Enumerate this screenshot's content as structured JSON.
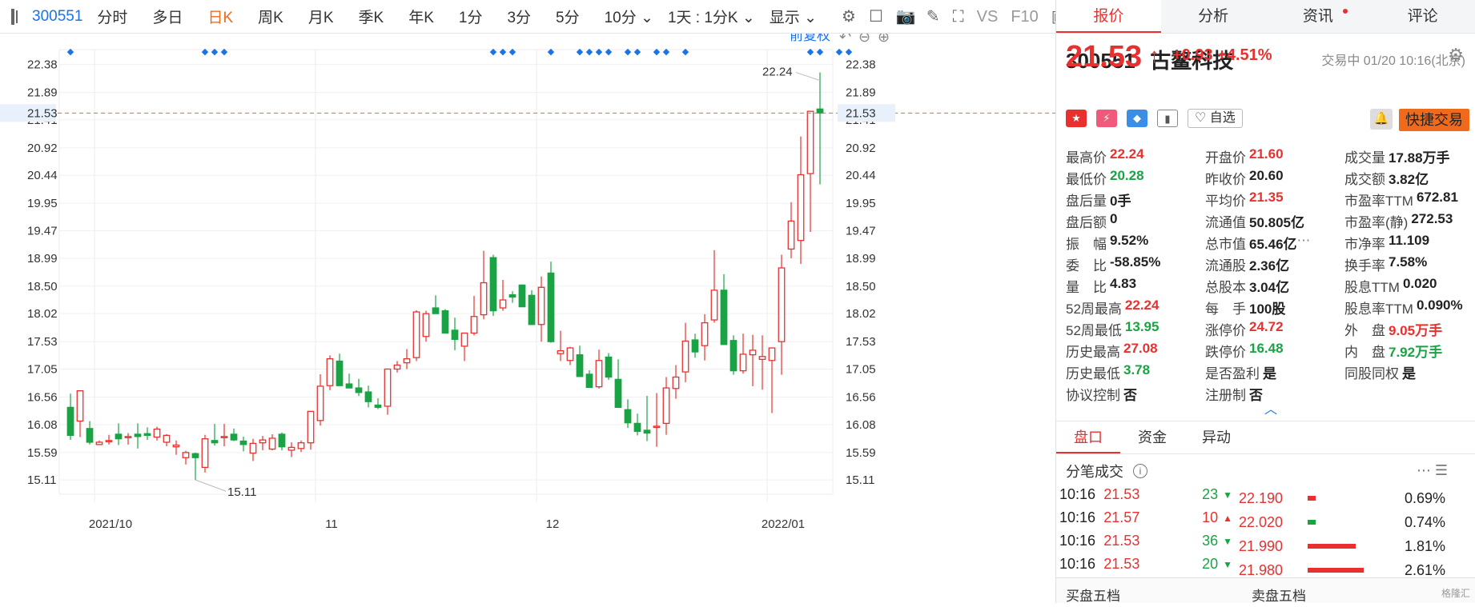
{
  "toolbar": {
    "code": "300551",
    "items": [
      "分时",
      "多日",
      "日K",
      "周K",
      "月K",
      "季K",
      "年K",
      "1分",
      "3分",
      "5分",
      "10分 ⌄",
      "1天 : 1分K ⌄",
      "显示 ⌄"
    ],
    "active_index": 2,
    "right_icons": [
      "gear-icon",
      "square-icon",
      "camera-icon",
      "pen-icon",
      "fullscreen-icon",
      "VS",
      "F10",
      "panel-icon"
    ]
  },
  "chart": {
    "restore_label": "前复权",
    "current_price_label": "21.53",
    "max_label": "22.24",
    "min_label": "15.11",
    "accent_red": "#e8312f",
    "accent_green": "#1aa345",
    "dash_line_color": "#f06a1c"
  },
  "chart_data": {
    "type": "candlestick",
    "y_ticks": [
      15.11,
      15.59,
      16.08,
      16.56,
      17.05,
      17.53,
      18.02,
      18.5,
      18.99,
      19.47,
      19.95,
      20.44,
      20.92,
      21.41,
      21.89,
      22.38
    ],
    "x_labels": [
      "2021/10",
      "11",
      "12",
      "2022/01"
    ],
    "ylim": [
      15.0,
      22.5
    ],
    "candles": [
      [
        16.38,
        16.62,
        15.81,
        15.89
      ],
      [
        16.14,
        16.67,
        15.86,
        16.67
      ],
      [
        16.01,
        16.14,
        15.73,
        15.77
      ],
      [
        15.73,
        15.8,
        15.72,
        15.77
      ],
      [
        15.8,
        15.9,
        15.73,
        15.8
      ],
      [
        15.91,
        16.1,
        15.72,
        15.83
      ],
      [
        15.85,
        15.93,
        15.73,
        15.87
      ],
      [
        15.91,
        16.1,
        15.66,
        15.87
      ],
      [
        15.92,
        16.03,
        15.81,
        15.89
      ],
      [
        15.86,
        16.04,
        15.8,
        16.0
      ],
      [
        15.77,
        15.91,
        15.7,
        15.89
      ],
      [
        15.69,
        15.8,
        15.55,
        15.72
      ],
      [
        15.5,
        15.62,
        15.38,
        15.59
      ],
      [
        15.57,
        15.59,
        15.11,
        15.5
      ],
      [
        15.33,
        15.9,
        15.24,
        15.83
      ],
      [
        15.8,
        16.09,
        15.71,
        15.76
      ],
      [
        15.85,
        16.09,
        15.7,
        15.87
      ],
      [
        15.91,
        16.01,
        15.79,
        15.81
      ],
      [
        15.79,
        15.87,
        15.61,
        15.73
      ],
      [
        15.58,
        15.83,
        15.44,
        15.75
      ],
      [
        15.76,
        15.88,
        15.63,
        15.81
      ],
      [
        15.65,
        15.91,
        15.63,
        15.84
      ],
      [
        15.91,
        15.94,
        15.63,
        15.69
      ],
      [
        15.63,
        15.77,
        15.51,
        15.68
      ],
      [
        15.66,
        15.8,
        15.6,
        15.76
      ],
      [
        15.76,
        16.31,
        15.64,
        16.31
      ],
      [
        16.15,
        16.96,
        16.06,
        16.75
      ],
      [
        16.76,
        17.29,
        16.68,
        17.23
      ],
      [
        17.19,
        17.32,
        16.82,
        16.76
      ],
      [
        16.79,
        16.97,
        16.72,
        16.72
      ],
      [
        16.72,
        16.88,
        16.58,
        16.64
      ],
      [
        16.65,
        16.76,
        16.38,
        16.48
      ],
      [
        16.42,
        16.54,
        16.35,
        16.38
      ],
      [
        16.4,
        17.06,
        16.25,
        17.05
      ],
      [
        17.05,
        17.19,
        16.99,
        17.12
      ],
      [
        17.16,
        17.4,
        17.05,
        17.23
      ],
      [
        17.25,
        18.08,
        17.19,
        18.05
      ],
      [
        17.62,
        18.07,
        17.53,
        18.02
      ],
      [
        18.12,
        18.34,
        18.03,
        18.02
      ],
      [
        18.07,
        18.1,
        17.8,
        17.68
      ],
      [
        17.73,
        17.95,
        17.38,
        17.57
      ],
      [
        17.45,
        17.68,
        17.19,
        17.68
      ],
      [
        17.68,
        18.33,
        17.64,
        17.97
      ],
      [
        18.0,
        19.12,
        17.92,
        18.56
      ],
      [
        19.0,
        19.05,
        17.98,
        18.07
      ],
      [
        18.12,
        18.61,
        18.07,
        18.26
      ],
      [
        18.35,
        18.41,
        18.21,
        18.31
      ],
      [
        18.52,
        18.53,
        18.22,
        18.14
      ],
      [
        18.34,
        18.43,
        17.82,
        17.83
      ],
      [
        17.83,
        18.67,
        17.53,
        18.48
      ],
      [
        18.73,
        18.93,
        17.51,
        17.53
      ],
      [
        17.32,
        17.72,
        17.19,
        17.37
      ],
      [
        17.2,
        17.44,
        17.12,
        17.42
      ],
      [
        17.3,
        17.46,
        16.95,
        16.92
      ],
      [
        16.96,
        17.03,
        16.77,
        16.73
      ],
      [
        16.74,
        17.39,
        16.71,
        17.2
      ],
      [
        17.26,
        17.33,
        16.86,
        16.91
      ],
      [
        16.87,
        17.22,
        16.52,
        16.38
      ],
      [
        16.34,
        16.52,
        16.02,
        16.11
      ],
      [
        16.1,
        16.27,
        15.89,
        15.96
      ],
      [
        15.98,
        16.58,
        15.79,
        15.93
      ],
      [
        16.04,
        16.63,
        15.69,
        16.05
      ],
      [
        16.1,
        16.91,
        15.9,
        16.72
      ],
      [
        16.71,
        17.12,
        16.53,
        16.91
      ],
      [
        17.0,
        17.86,
        16.82,
        17.54
      ],
      [
        17.56,
        17.67,
        17.25,
        17.35
      ],
      [
        17.46,
        18.01,
        17.2,
        17.86
      ],
      [
        17.91,
        19.13,
        17.86,
        18.43
      ],
      [
        18.43,
        18.71,
        17.49,
        17.48
      ],
      [
        17.55,
        17.64,
        16.95,
        17.02
      ],
      [
        17.02,
        17.67,
        16.97,
        17.31
      ],
      [
        17.3,
        17.65,
        16.75,
        17.38
      ],
      [
        17.22,
        17.64,
        16.69,
        17.27
      ],
      [
        17.2,
        17.4,
        16.28,
        17.42
      ],
      [
        17.53,
        19.05,
        16.95,
        18.82
      ],
      [
        19.15,
        19.97,
        18.99,
        19.64
      ],
      [
        19.3,
        21.12,
        18.89,
        20.45
      ],
      [
        20.47,
        21.34,
        19.45,
        21.56
      ],
      [
        21.6,
        22.24,
        20.28,
        21.53
      ]
    ]
  },
  "right": {
    "tabs": [
      "报价",
      "分析",
      "资讯",
      "评论"
    ],
    "code": "300551",
    "name": "古鳌科技",
    "price": "21.53",
    "change": "+0.93 +4.51%",
    "status": "交易中 01/20 10:16(北京)",
    "zixuan": "自选",
    "quick_trade": "快捷交易",
    "stats": [
      [
        [
          "最高价",
          "22.24",
          "red"
        ],
        [
          "开盘价",
          "21.60",
          "red"
        ],
        [
          "成交量",
          "17.88万手",
          ""
        ]
      ],
      [
        [
          "最低价",
          "20.28",
          "green"
        ],
        [
          "昨收价",
          "20.60",
          ""
        ],
        [
          "成交额",
          "3.82亿",
          ""
        ]
      ],
      [
        [
          "盘后量",
          "0手",
          ""
        ],
        [
          "平均价",
          "21.35",
          "red"
        ],
        [
          "市盈率TTM",
          "672.81",
          ""
        ]
      ],
      [
        [
          "盘后额",
          "0",
          ""
        ],
        [
          "流通值",
          "50.805亿",
          ""
        ],
        [
          "市盈率(静)",
          "272.53",
          ""
        ]
      ],
      [
        [
          "振　幅",
          "9.52%",
          ""
        ],
        [
          "总市值",
          "65.46亿",
          ""
        ],
        [
          "市净率",
          "11.109",
          ""
        ]
      ],
      [
        [
          "委　比",
          "-58.85%",
          ""
        ],
        [
          "流通股",
          "2.36亿",
          ""
        ],
        [
          "换手率",
          "7.58%",
          ""
        ]
      ],
      [
        [
          "量　比",
          "4.83",
          ""
        ],
        [
          "总股本",
          "3.04亿",
          ""
        ],
        [
          "股息TTM",
          "0.020",
          ""
        ]
      ],
      [
        [
          "52周最高",
          "22.24",
          "red"
        ],
        [
          "每　手",
          "100股",
          ""
        ],
        [
          "股息率TTM",
          "0.090%",
          ""
        ]
      ],
      [
        [
          "52周最低",
          "13.95",
          "green"
        ],
        [
          "涨停价",
          "24.72",
          "red"
        ],
        [
          "外　盘",
          "9.05万手",
          "red"
        ]
      ],
      [
        [
          "历史最高",
          "27.08",
          "red"
        ],
        [
          "跌停价",
          "16.48",
          "green"
        ],
        [
          "内　盘",
          "7.92万手",
          "green"
        ]
      ],
      [
        [
          "历史最低",
          "3.78",
          "green"
        ],
        [
          "是否盈利",
          "是",
          ""
        ],
        [
          "同股同权",
          "是",
          ""
        ]
      ],
      [
        [
          "协议控制",
          "否",
          ""
        ],
        [
          "注册制",
          "否",
          ""
        ],
        [
          "",
          "",
          " "
        ]
      ]
    ],
    "subtabs": [
      "盘口",
      "资金",
      "异动"
    ],
    "fb_title": "分笔成交",
    "fb": [
      [
        "10:16",
        "21.53",
        "23",
        "green",
        "down"
      ],
      [
        "10:16",
        "21.57",
        "10",
        "red",
        "up"
      ],
      [
        "10:16",
        "21.53",
        "36",
        "green",
        "down"
      ],
      [
        "10:16",
        "21.53",
        "20",
        "green",
        "down"
      ]
    ],
    "depth": [
      [
        "22.190",
        0.1,
        "red",
        "0.69%"
      ],
      [
        "22.020",
        0.1,
        "green",
        "0.74%"
      ],
      [
        "21.990",
        0.6,
        "red",
        "1.81%"
      ],
      [
        "21.980",
        0.7,
        "red",
        "2.61%"
      ]
    ],
    "bottom": [
      "买盘五档",
      "卖盘五档"
    ],
    "watermark": "格隆汇"
  }
}
